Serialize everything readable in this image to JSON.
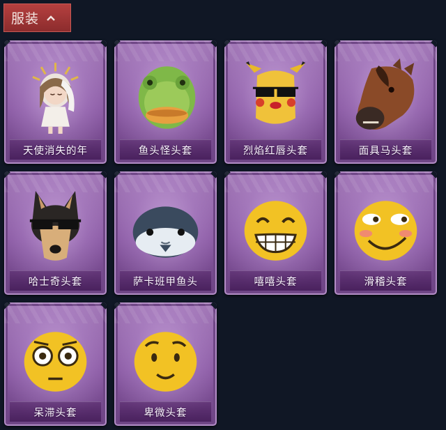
{
  "header": {
    "title": "服装",
    "chevron_icon": "chevron-up-icon"
  },
  "theme": {
    "background": "#101725",
    "header_bg": "#a33837",
    "card_purple": "#9a6db2"
  },
  "items": [
    {
      "label": "天使消失的年",
      "icon": "angel-doll-costume"
    },
    {
      "label": "鱼头怪头套",
      "icon": "fish-head-mask"
    },
    {
      "label": "烈焰红唇头套",
      "icon": "yellow-creature-mask-sunglasses"
    },
    {
      "label": "面具马头套",
      "icon": "horse-head-mask"
    },
    {
      "label": "哈士奇头套",
      "icon": "husky-dog-mask-sunglasses"
    },
    {
      "label": "萨卡班甲鱼头",
      "icon": "sacabambaspis-fish-head"
    },
    {
      "label": "嘻嘻头套",
      "icon": "grinning-emoji-head"
    },
    {
      "label": "滑稽头套",
      "icon": "smirk-emoji-head"
    },
    {
      "label": "呆滞头套",
      "icon": "dazed-emoji-head"
    },
    {
      "label": "卑微头套",
      "icon": "humble-emoji-head"
    }
  ]
}
